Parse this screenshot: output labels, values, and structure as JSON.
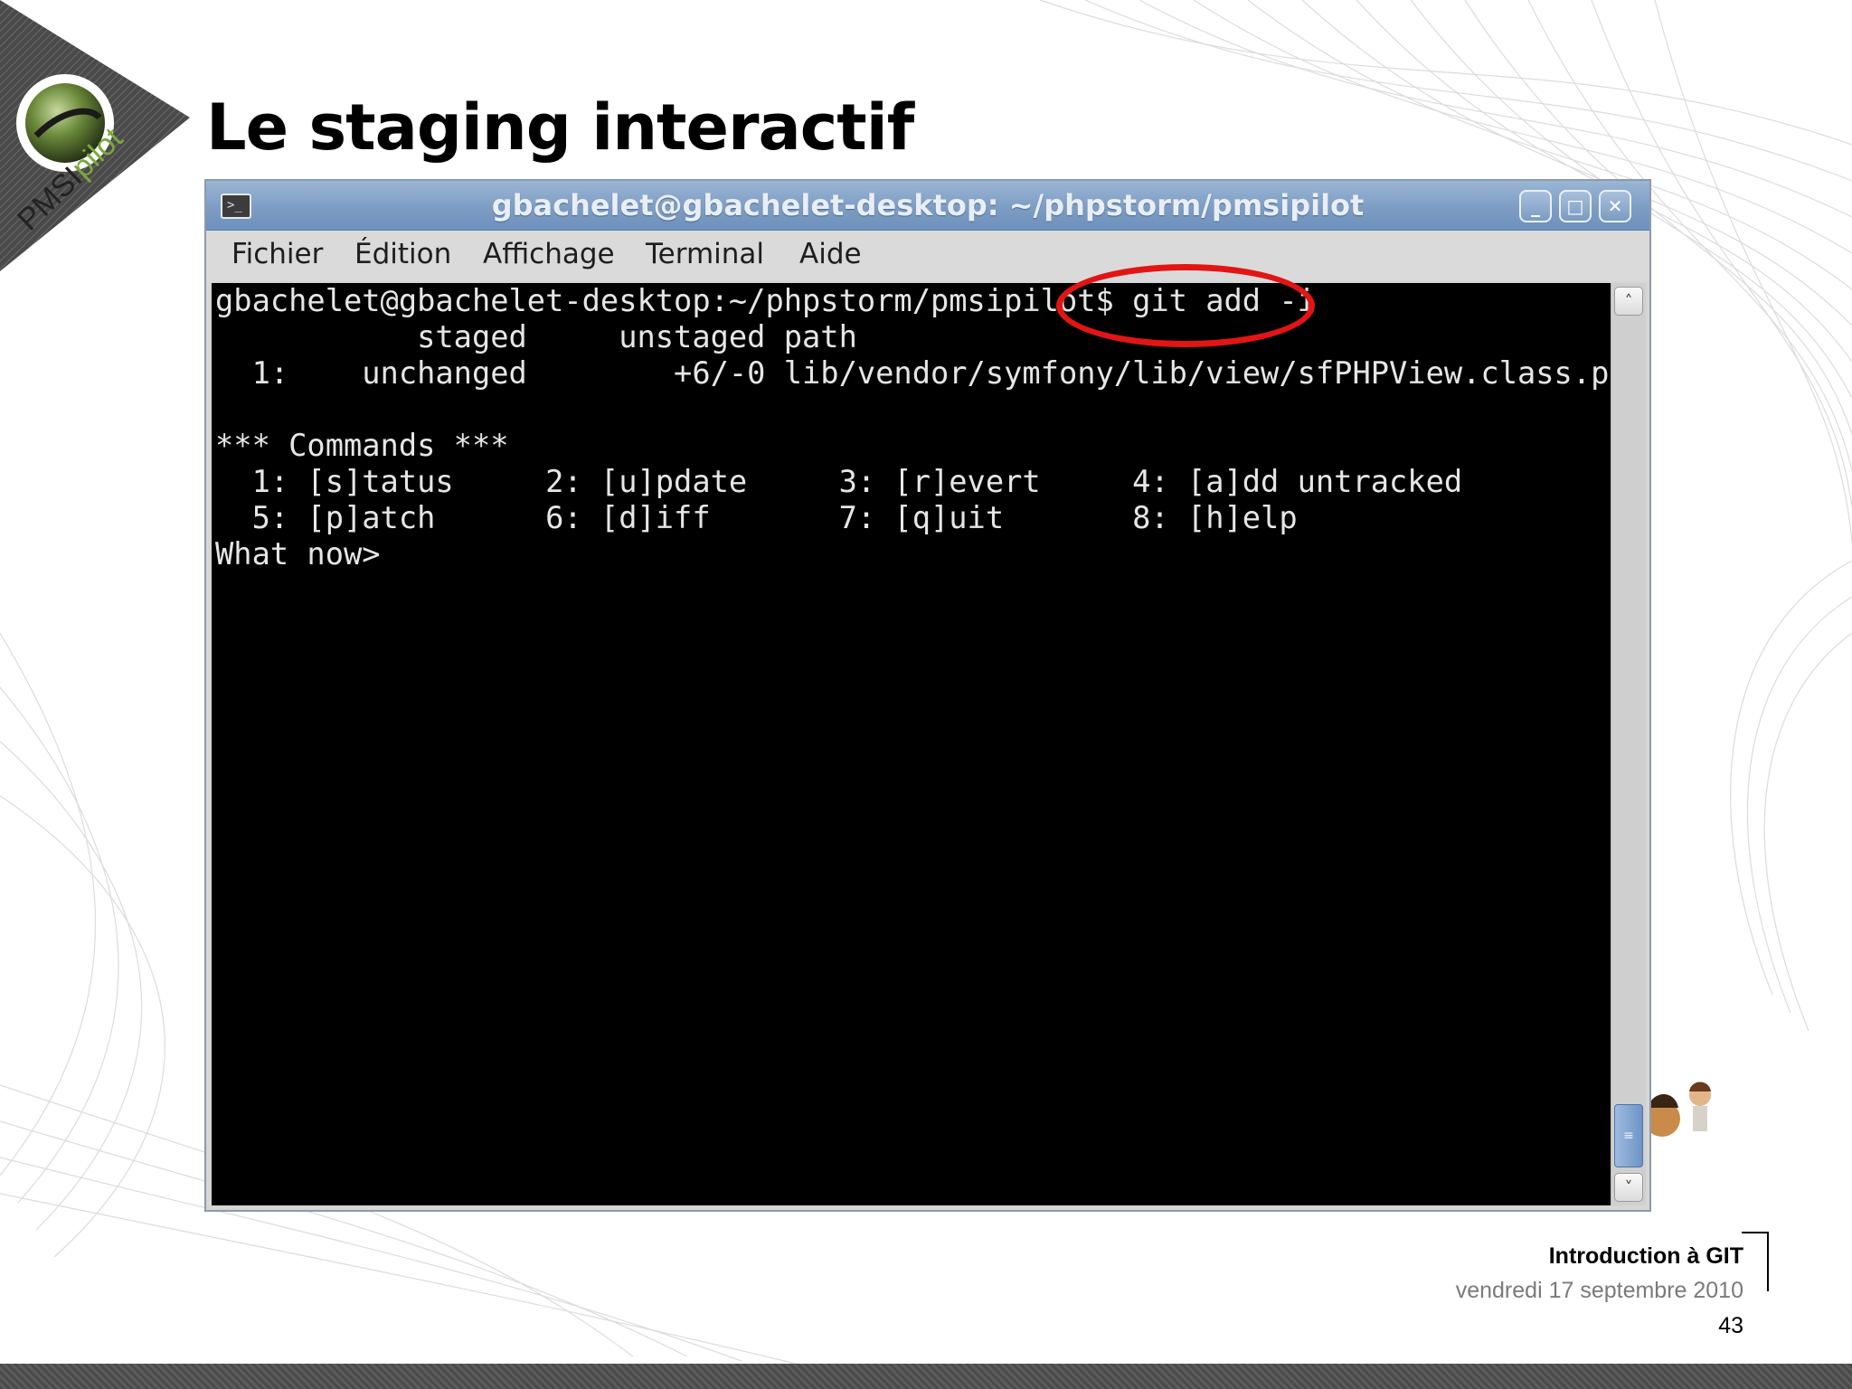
{
  "slide": {
    "title": "Le staging interactif",
    "logo": {
      "part1": "PMSI",
      "part2": "pilot",
      "accent_color": "#7aa83a"
    },
    "footer": {
      "title": "Introduction à GIT",
      "date": "vendredi 17 septembre 2010",
      "page": "43"
    }
  },
  "window": {
    "title": "gbachelet@gbachelet-desktop: ~/phpstorm/pmsipilot",
    "buttons": {
      "minimize": "_",
      "maximize": "□",
      "close": "✕"
    },
    "menu": [
      {
        "label": "Fichier"
      },
      {
        "label": "Édition"
      },
      {
        "label": "Affichage"
      },
      {
        "label": "Terminal"
      },
      {
        "label": "Aide"
      }
    ]
  },
  "terminal": {
    "lines": [
      "gbachelet@gbachelet-desktop:~/phpstorm/pmsipilot$ git add -i",
      "           staged     unstaged path",
      "  1:    unchanged        +6/-0 lib/vendor/symfony/lib/view/sfPHPView.class.php",
      "",
      "*** Commands ***",
      "  1: [s]tatus     2: [u]pdate     3: [r]evert     4: [a]dd untracked",
      "  5: [p]atch      6: [d]iff       7: [q]uit       8: [h]elp",
      "What now>"
    ],
    "highlight_color": "#e21515"
  },
  "scrollbar": {
    "up": "˄",
    "down": "˅",
    "thumb": "≡"
  }
}
